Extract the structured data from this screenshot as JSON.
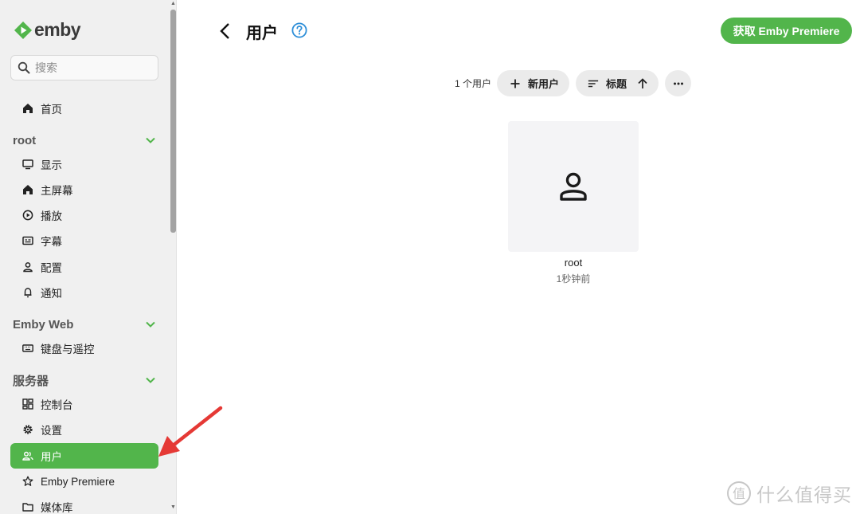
{
  "brand": {
    "name": "emby",
    "accent": "#52b54b"
  },
  "sidebar": {
    "search_placeholder": "搜索",
    "home_label": "首页",
    "sections": [
      {
        "title": "root",
        "items": [
          "显示",
          "主屏幕",
          "播放",
          "字幕",
          "配置",
          "通知"
        ]
      },
      {
        "title": "Emby Web",
        "items": [
          "键盘与遥控"
        ]
      },
      {
        "title": "服务器",
        "items": [
          "控制台",
          "设置",
          "用户",
          "Emby Premiere",
          "媒体库"
        ]
      }
    ],
    "active_item": "用户"
  },
  "header": {
    "title": "用户",
    "premiere_button": "获取 Emby Premiere"
  },
  "toolbar": {
    "count_text": "1 个用户",
    "add_user_label": "新用户",
    "sort_label": "标题"
  },
  "users": [
    {
      "name": "root",
      "last_seen": "1秒钟前"
    }
  ],
  "watermark": {
    "text": "什么值得买",
    "icon": "zhidemai-logo"
  }
}
